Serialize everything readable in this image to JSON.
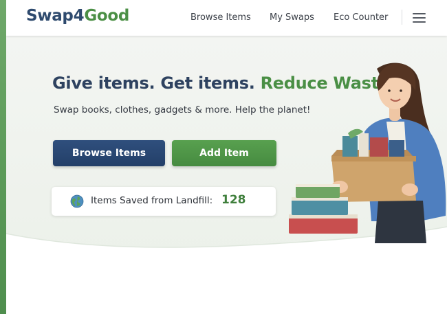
{
  "brand": {
    "name_part1": "Swap4",
    "name_part2": "Good"
  },
  "nav": {
    "browse_label": "Browse Items",
    "swaps_label": "My Swaps",
    "eco_label": "Eco Counter",
    "menu_icon": "hamburger-menu-icon"
  },
  "hero": {
    "headline_part1": "Give items. Get items.",
    "headline_part2": "Reduce Waste!",
    "subtitle": "Swap books, clothes, gadgets & more. Help the planet!",
    "browse_button": "Browse Items",
    "add_button": "Add Item",
    "counter_label": "Items Saved from Landfill:",
    "counter_value": "128",
    "counter_icon": "globe-icon",
    "illustration": "woman-holding-box-of-books"
  },
  "colors": {
    "brand_navy": "#2e4a6e",
    "brand_green": "#4b8f45",
    "primary_button": "#2a4a76",
    "secondary_button": "#4f9647",
    "counter_value": "#3f7f3c"
  }
}
